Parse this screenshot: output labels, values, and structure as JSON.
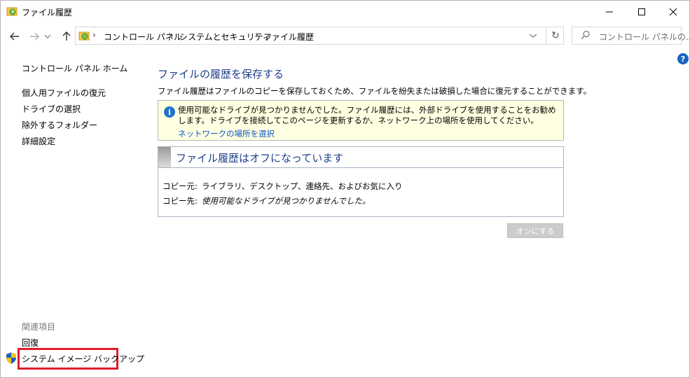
{
  "window": {
    "title": "ファイル履歴",
    "minimize_icon": "minimize-icon",
    "maximize_icon": "maximize-icon",
    "close_icon": "close-icon"
  },
  "address_bar": {
    "breadcrumbs": [
      "コントロール パネル",
      "システムとセキュリティ",
      "ファイル履歴"
    ],
    "separator": "›",
    "search_placeholder": "コントロール パネルの..."
  },
  "sidebar": {
    "home_link": "コントロール パネル ホーム",
    "links": [
      "個人用ファイルの復元",
      "ドライブの選択",
      "除外するフォルダー",
      "詳細設定"
    ],
    "related_heading": "関連項目",
    "related_links": [
      "回復",
      "システム イメージ バックアップ"
    ]
  },
  "main": {
    "title": "ファイルの履歴を保存する",
    "description": "ファイル履歴はファイルのコピーを保存しておくため、ファイルを紛失または破損した場合に復元することができます。",
    "info_text": "使用可能なドライブが見つかりませんでした。ファイル履歴には、外部ドライブを使用することをお勧めします。ドライブを接続してこのページを更新するか、ネットワーク上の場所を使用してください。",
    "info_link": "ネットワークの場所を選択",
    "status_title": "ファイル履歴はオフになっています",
    "copy_from_label": "コピー元:",
    "copy_from_value": "ライブラリ、デスクトップ、連絡先、およびお気に入り",
    "copy_to_label": "コピー先:",
    "copy_to_value": "使用可能なドライブが見つかりませんでした。",
    "turn_on_button": "オンにする"
  },
  "colors": {
    "accent_title": "#1e3f8a",
    "link": "#0a58ca",
    "info_background": "#ffffe1",
    "highlight": "#e01e2b"
  }
}
